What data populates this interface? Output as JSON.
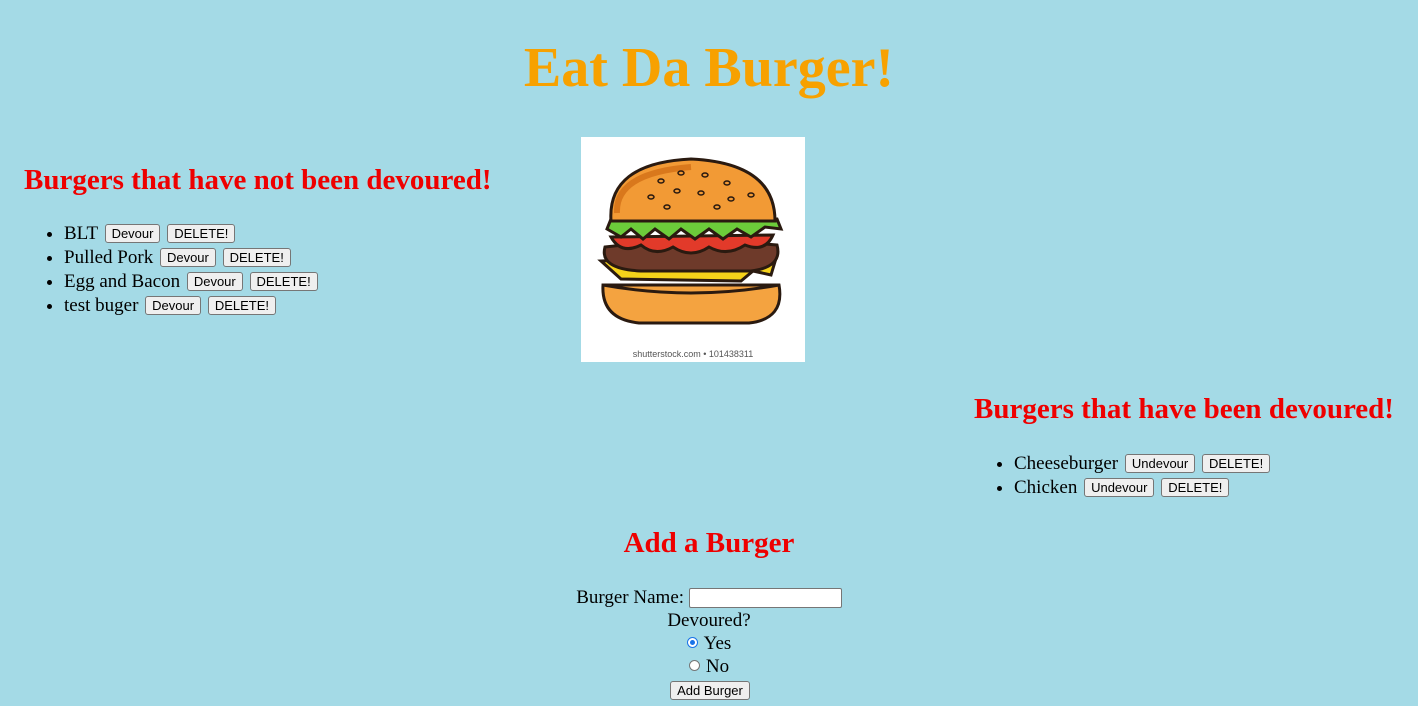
{
  "page": {
    "title": "Eat Da Burger!"
  },
  "not_devoured": {
    "heading": "Burgers that have not been devoured!",
    "items": [
      {
        "name": "BLT",
        "action_label": "Devour",
        "delete_label": "DELETE!"
      },
      {
        "name": "Pulled Pork",
        "action_label": "Devour",
        "delete_label": "DELETE!"
      },
      {
        "name": "Egg and Bacon",
        "action_label": "Devour",
        "delete_label": "DELETE!"
      },
      {
        "name": "test buger",
        "action_label": "Devour",
        "delete_label": "DELETE!"
      }
    ]
  },
  "devoured": {
    "heading": "Burgers that have been devoured!",
    "items": [
      {
        "name": "Cheeseburger",
        "action_label": "Undevour",
        "delete_label": "DELETE!"
      },
      {
        "name": "Chicken",
        "action_label": "Undevour",
        "delete_label": "DELETE!"
      }
    ]
  },
  "image": {
    "watermark": "shutterstock.com • 101438311",
    "icon": "burger-illustration"
  },
  "add_form": {
    "heading": "Add a Burger",
    "name_label": "Burger Name:",
    "name_value": "",
    "devoured_label": "Devoured?",
    "options": [
      {
        "label": "Yes",
        "checked": true
      },
      {
        "label": "No",
        "checked": false
      }
    ],
    "submit_label": "Add Burger"
  },
  "colors": {
    "background": "#a4dae6",
    "title": "#f7a100",
    "heading": "#ee0000"
  }
}
